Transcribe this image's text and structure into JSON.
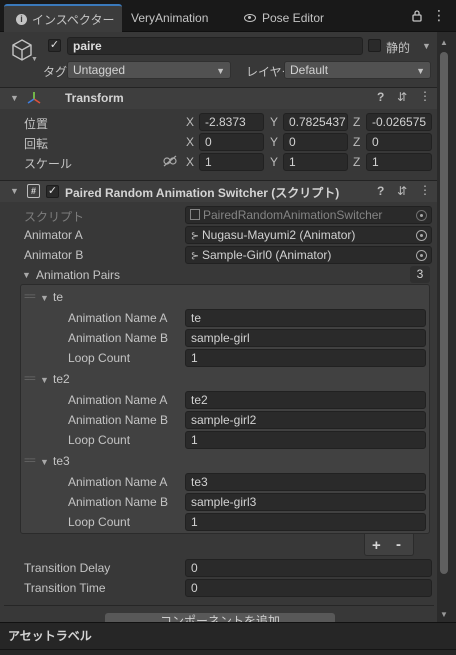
{
  "tabs": [
    {
      "label": "インスペクター",
      "active": true,
      "icon": "info-icon"
    },
    {
      "label": "VeryAnimation",
      "active": false
    },
    {
      "label": "Pose Editor",
      "active": false,
      "icon": "eye-icon"
    }
  ],
  "object": {
    "name": "paire",
    "static_label": "静的",
    "tag_label": "タグ",
    "tag_value": "Untagged",
    "layer_label": "レイヤー",
    "layer_value": "Default"
  },
  "transform": {
    "title": "Transform",
    "position_label": "位置",
    "rotation_label": "回転",
    "scale_label": "スケール",
    "axes": [
      "X",
      "Y",
      "Z"
    ],
    "position": [
      "-2.8373",
      "0.7825437",
      "-0.026575"
    ],
    "rotation": [
      "0",
      "0",
      "0"
    ],
    "scale": [
      "1",
      "1",
      "1"
    ]
  },
  "script_component": {
    "title": "Paired Random Animation Switcher (スクリプト)",
    "script_label": "スクリプト",
    "script_value": "PairedRandomAnimationSwitcher",
    "animator_a_label": "Animator A",
    "animator_a_value": "Nugasu-Mayumi2 (Animator)",
    "animator_b_label": "Animator B",
    "animator_b_value": "Sample-Girl0 (Animator)",
    "pairs_label": "Animation Pairs",
    "pairs_count": "3",
    "name_a_label": "Animation Name A",
    "name_b_label": "Animation Name B",
    "loop_label": "Loop Count",
    "pairs": [
      {
        "title": "te",
        "name_a": "te",
        "name_b": "sample-girl",
        "loop": "1"
      },
      {
        "title": "te2",
        "name_a": "te2",
        "name_b": "sample-girl2",
        "loop": "1"
      },
      {
        "title": "te3",
        "name_a": "te3",
        "name_b": "sample-girl3",
        "loop": "1"
      }
    ],
    "add_label": "+",
    "remove_label": "-",
    "transition_delay_label": "Transition Delay",
    "transition_delay_value": "0",
    "transition_time_label": "Transition Time",
    "transition_time_value": "0"
  },
  "add_component_label": "コンポーネントを追加",
  "asset_label_title": "アセットラベル",
  "colors": {
    "accent": "#3a79bb",
    "panel": "#383838",
    "field": "#2a2a2a"
  }
}
